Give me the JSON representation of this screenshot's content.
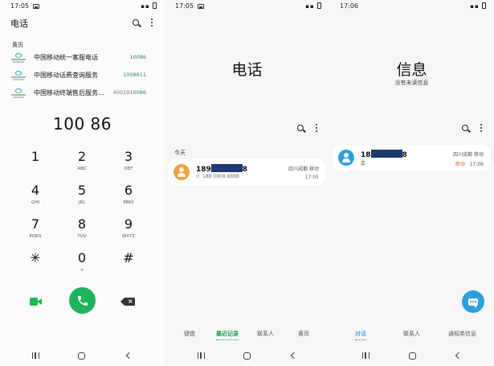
{
  "colors": {
    "accent_green": "#1fb35b",
    "accent_blue": "#2d9fe0",
    "redaction": "#1d3a74"
  },
  "dialer": {
    "status": {
      "time": "17:05"
    },
    "title": "电话",
    "yellow_pages_label": "黄页",
    "yellow_pages": [
      {
        "name": "中国移动统一客服电话",
        "number_prefix": "",
        "number": "10086"
      },
      {
        "name": "中国移动话费查询服务",
        "number_prefix": "",
        "number": "1008611"
      },
      {
        "name": "中国移动终端售后服务...",
        "number_prefix": "400191",
        "number": "0086"
      }
    ],
    "entered_number": "100 86",
    "keys": [
      {
        "digit": "1",
        "letters": ""
      },
      {
        "digit": "2",
        "letters": "ABC"
      },
      {
        "digit": "3",
        "letters": "DEF"
      },
      {
        "digit": "4",
        "letters": "GHI"
      },
      {
        "digit": "5",
        "letters": "JKL"
      },
      {
        "digit": "6",
        "letters": "MNO"
      },
      {
        "digit": "7",
        "letters": "PQRS"
      },
      {
        "digit": "8",
        "letters": "TUV"
      },
      {
        "digit": "9",
        "letters": "WXYZ"
      },
      {
        "digit": "✳",
        "letters": ""
      },
      {
        "digit": "0",
        "letters": "+"
      },
      {
        "digit": "#",
        "letters": ""
      }
    ],
    "icons": {
      "video": "video-call-icon",
      "call": "phone-icon",
      "backspace": "backspace-icon"
    }
  },
  "recents": {
    "status": {
      "time": "17:05"
    },
    "title": "电话",
    "day_label": "今天",
    "entry": {
      "name_start": "189",
      "name_end": "8",
      "number": "188 0808 8888",
      "location": "四川成都 移动",
      "time": "17:05"
    },
    "tabs": [
      "键盘",
      "最近记录",
      "联系人",
      "黄页"
    ],
    "active_tab": "最近记录"
  },
  "messages": {
    "status": {
      "time": "17:06"
    },
    "title": "信息",
    "subtitle": "没有未读信息",
    "entry": {
      "name_start": "18",
      "name_end": "8",
      "preview": "嘉",
      "location": "四川成都 移动",
      "tag": "移动",
      "time": "17:06"
    },
    "tabs": [
      "对话",
      "联系人",
      "通知类信息"
    ],
    "active_tab": "对话"
  }
}
